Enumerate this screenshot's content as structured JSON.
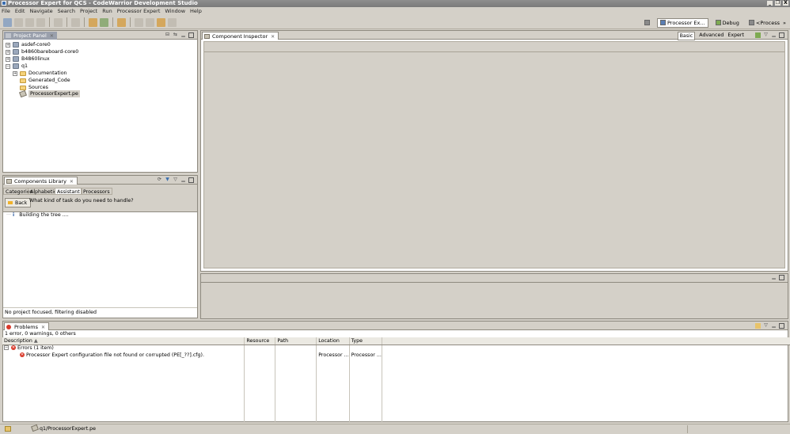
{
  "window": {
    "title": "Processor Expert for QCS - CodeWarrior Development Studio",
    "controls": [
      "_",
      "❐",
      "X"
    ]
  },
  "menu": [
    "File",
    "Edit",
    "Navigate",
    "Search",
    "Project",
    "Run",
    "Processor Expert",
    "Window",
    "Help"
  ],
  "perspectives": [
    {
      "label": "Processor Ex...",
      "active": true
    },
    {
      "label": "Debug",
      "active": false
    },
    {
      "label": "<Process",
      "active": false
    }
  ],
  "projectPanel": {
    "tab": "Project Panel",
    "tree": [
      {
        "label": "asdef-core0",
        "level": 0,
        "expander": "+",
        "icon": "project-icon"
      },
      {
        "label": "b4860bareboard-core0",
        "level": 0,
        "expander": "+",
        "icon": "project-icon"
      },
      {
        "label": "B4860linux",
        "level": 0,
        "expander": "+",
        "icon": "project-icon"
      },
      {
        "label": "q1",
        "level": 0,
        "expander": "−",
        "icon": "project-icon"
      },
      {
        "label": "Documentation",
        "level": 1,
        "expander": "+",
        "icon": "folder-icon"
      },
      {
        "label": "Generated_Code",
        "level": 1,
        "expander": "",
        "icon": "folder-icon"
      },
      {
        "label": "Sources",
        "level": 1,
        "expander": "",
        "icon": "folder-icon"
      },
      {
        "label": "ProcessorExpert.pe",
        "level": 1,
        "expander": "",
        "icon": "pe-file-icon",
        "selected": true
      }
    ]
  },
  "componentInspector": {
    "tab": "Component Inspector",
    "modes": [
      "Basic",
      "Advanced",
      "Expert"
    ]
  },
  "componentsLibrary": {
    "tab": "Components Library",
    "subtabs": [
      "Categories",
      "Alphabetical",
      "Assistant",
      "Processors"
    ],
    "activeSubtab": "Assistant",
    "back": "Back",
    "question": "What kind of task do you need to handle?",
    "status": "Building the tree ....",
    "footer": "No project focused, filtering disabled"
  },
  "problems": {
    "tab": "Problems",
    "summary": "1 error, 0 warnings, 0 others",
    "columns": [
      "Description",
      "Resource",
      "Path",
      "Location",
      "Type"
    ],
    "group": "Errors (1 item)",
    "row": {
      "description": "Processor Expert configuration file not found or corrupted (PE[_??].cfg).",
      "resource": "",
      "path": "",
      "location": "Processor ...",
      "type": "Processor ..."
    }
  },
  "statusbar": {
    "file": "q1/ProcessorExpert.pe"
  },
  "colors": {
    "chrome": "#d4d0c8",
    "titlebar": "#7a7a7a",
    "errorRed": "#d93a2b",
    "folder": "#f5d27a"
  }
}
